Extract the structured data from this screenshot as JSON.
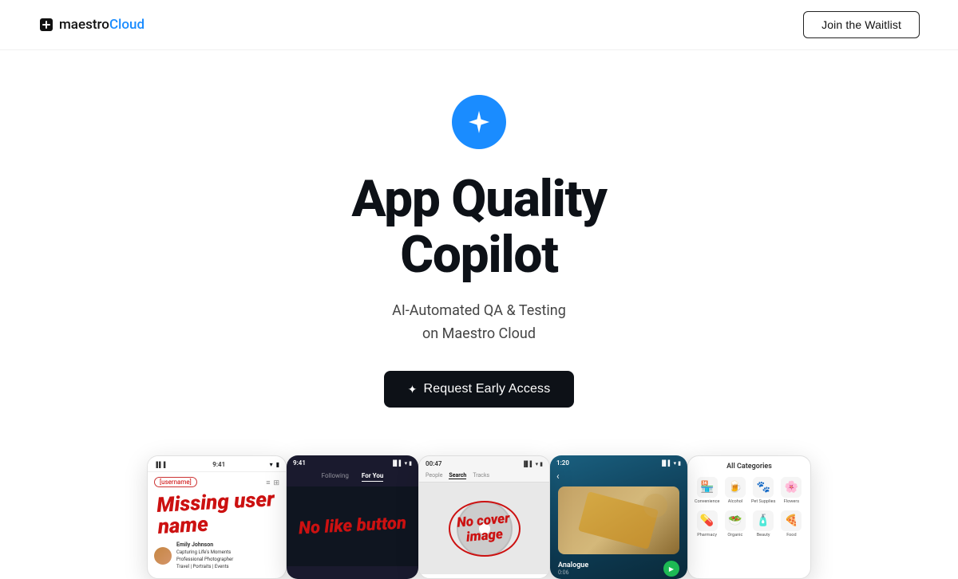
{
  "navbar": {
    "logo_text_regular": "maestro",
    "logo_text_blue": "Cloud",
    "waitlist_button": "Join the Waitlist"
  },
  "hero": {
    "icon_name": "star-sparkle-icon",
    "title_line1": "App Quality",
    "title_line2": "Copilot",
    "subtitle_line1": "AI-Automated QA & Testing",
    "subtitle_line2": "on Maestro Cloud",
    "cta_button": "Request Early Access"
  },
  "screenshots": {
    "card1": {
      "annotation": "Missing user name",
      "username_label": "[username]",
      "user_name": "Emily Johnson",
      "user_bio_1": "Capturing Life's Moments",
      "user_bio_2": "Professional Photographer",
      "user_bio_3": "Travel | Portraits | Events"
    },
    "card2": {
      "tab_following": "Following",
      "tab_for_you": "For You",
      "annotation": "No like button"
    },
    "card3": {
      "annotation_line1": "No cover",
      "annotation_line2": "image"
    },
    "card4": {
      "time": "1:20",
      "song_title": "Analogue",
      "song_sub": "0:06"
    },
    "card5": {
      "header": "All Categories",
      "categories": [
        {
          "icon": "🏪",
          "label": "Convenience"
        },
        {
          "icon": "🍺",
          "label": "Alcohol"
        },
        {
          "icon": "🐾",
          "label": "Pet Supplies"
        },
        {
          "icon": "🌸",
          "label": "Flowers"
        },
        {
          "icon": "💊",
          "label": "Pharmacy"
        },
        {
          "icon": "🥗",
          "label": "Organic"
        },
        {
          "icon": "🧴",
          "label": "Beauty"
        },
        {
          "icon": "🍕",
          "label": "Food"
        }
      ]
    }
  }
}
